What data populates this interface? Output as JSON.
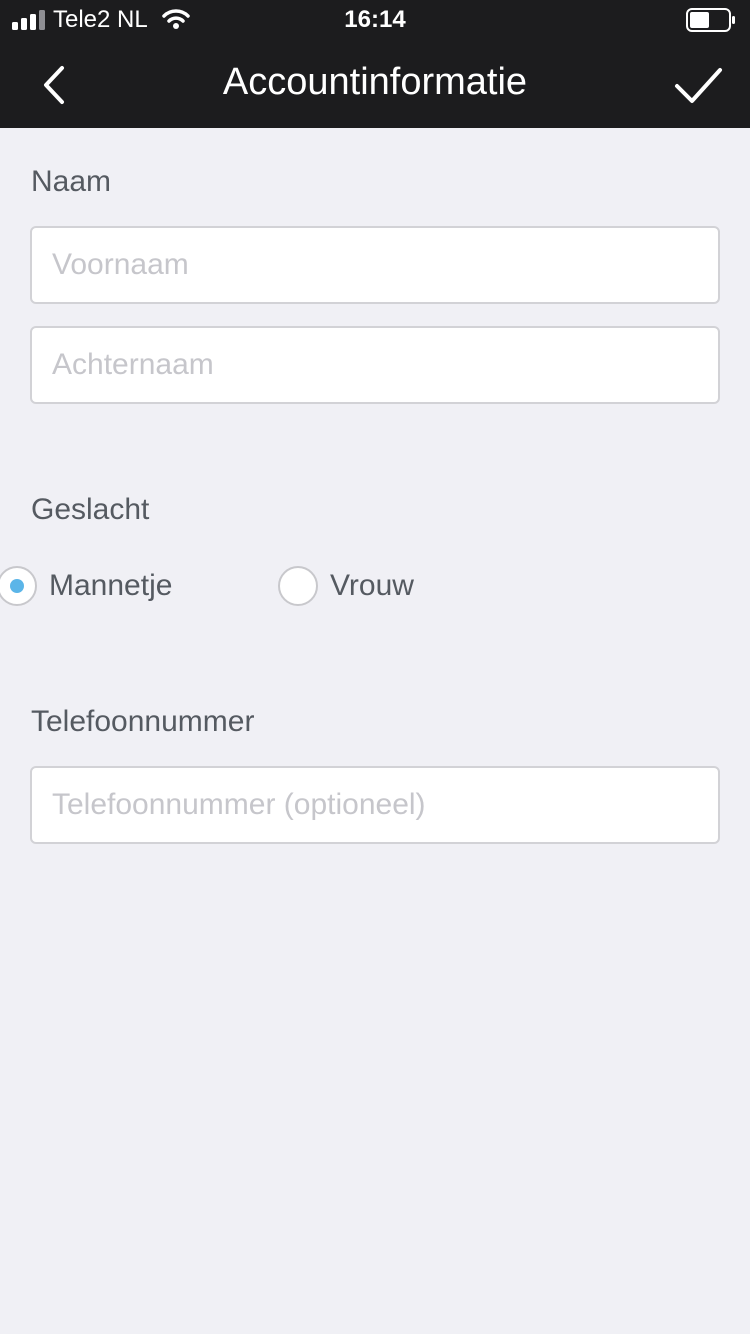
{
  "status_bar": {
    "carrier": "Tele2 NL",
    "time": "16:14",
    "battery_level": 0.5
  },
  "nav": {
    "title": "Accountinformatie"
  },
  "form": {
    "name_label": "Naam",
    "first_name": {
      "value": "",
      "placeholder": "Voornaam"
    },
    "last_name": {
      "value": "",
      "placeholder": "Achternaam"
    },
    "gender_label": "Geslacht",
    "gender_options": [
      {
        "label": "Mannetje",
        "selected": true
      },
      {
        "label": "Vrouw",
        "selected": false
      }
    ],
    "phone_label": "Telefoonnummer",
    "phone": {
      "value": "",
      "placeholder": "Telefoonnummer (optioneel)"
    }
  },
  "colors": {
    "nav_background": "#1c1c1e",
    "page_background": "#f0f0f5",
    "accent": "#5bb5e8"
  }
}
